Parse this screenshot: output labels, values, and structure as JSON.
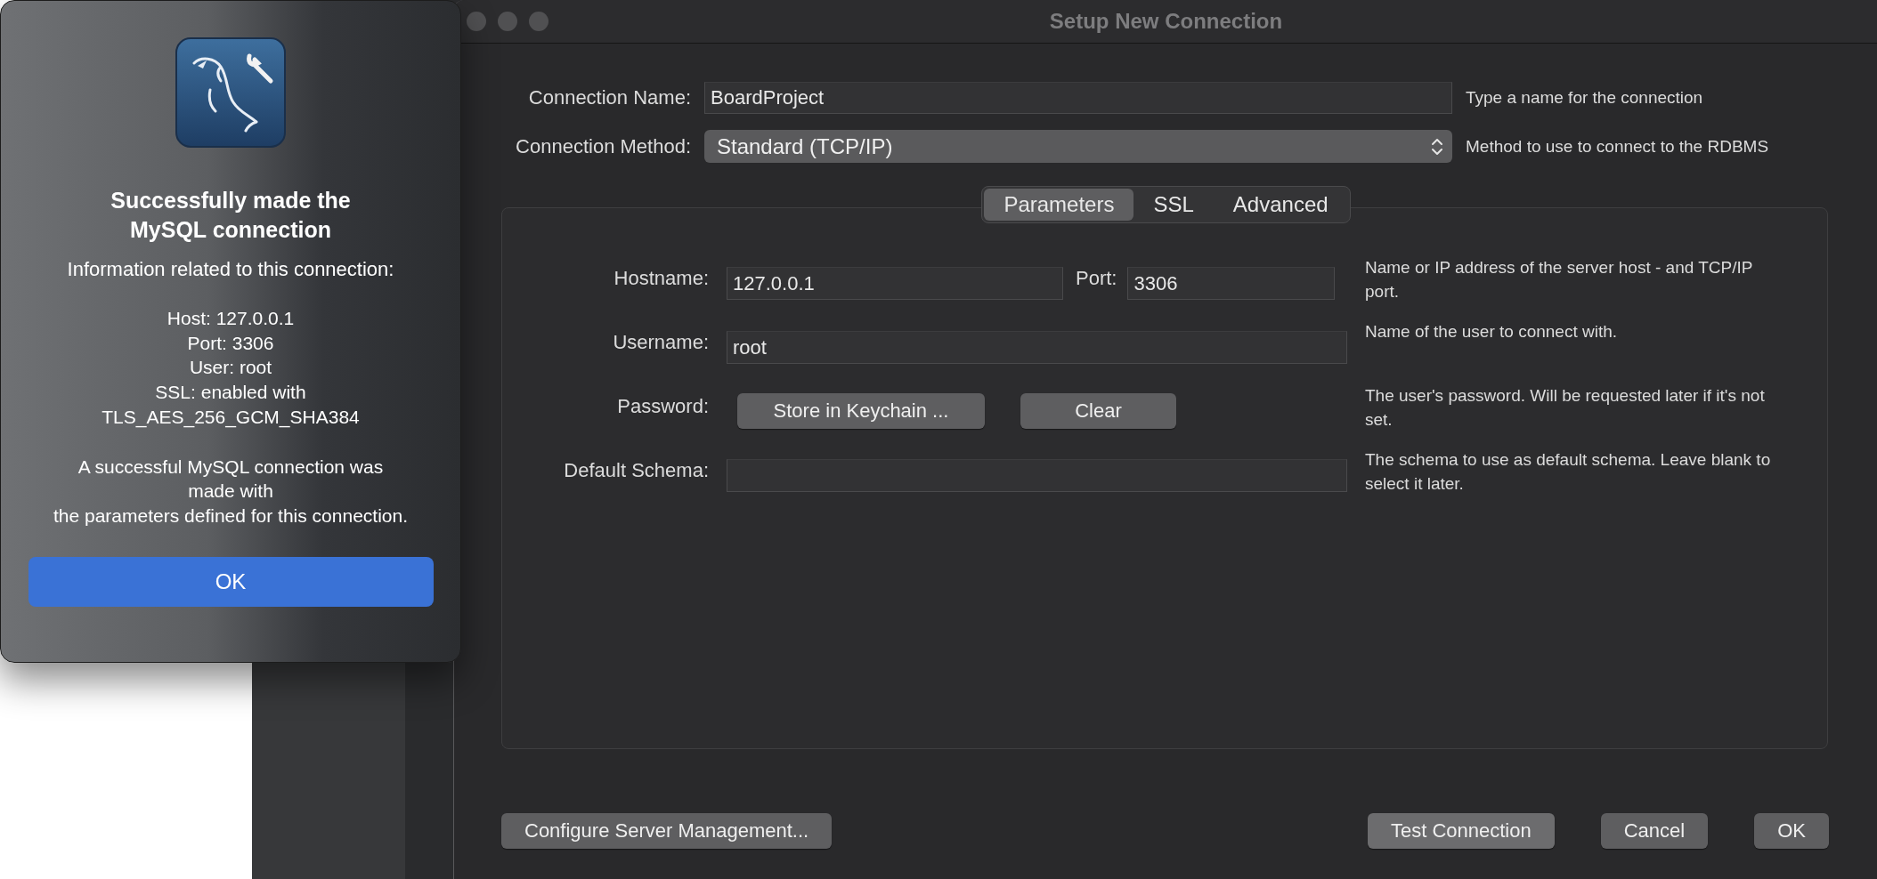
{
  "alert": {
    "title": "Successfully made the MySQL connection",
    "intro": "Information related to this connection:",
    "details": [
      "Host: 127.0.0.1",
      "Port: 3306",
      "User: root",
      "SSL: enabled with TLS_AES_256_GCM_SHA384"
    ],
    "message_lines": [
      "A successful MySQL connection was made with",
      "the parameters defined for this connection."
    ],
    "button": "OK"
  },
  "window": {
    "title": "Setup New Connection",
    "connection_name": {
      "label": "Connection Name:",
      "value": "BoardProject",
      "help": "Type a name for the connection"
    },
    "connection_method": {
      "label": "Connection Method:",
      "value": "Standard (TCP/IP)",
      "help": "Method to use to connect to the RDBMS"
    },
    "tabs": [
      {
        "label": "Parameters",
        "selected": true
      },
      {
        "label": "SSL",
        "selected": false
      },
      {
        "label": "Advanced",
        "selected": false
      }
    ],
    "parameters": {
      "hostname": {
        "label": "Hostname:",
        "value": "127.0.0.1"
      },
      "port": {
        "label": "Port:",
        "value": "3306"
      },
      "host_help": "Name or IP address of the server host - and TCP/IP port.",
      "username": {
        "label": "Username:",
        "value": "root",
        "help": "Name of the user to connect with."
      },
      "password": {
        "label": "Password:",
        "buttons": [
          "Store in Keychain ...",
          "Clear"
        ],
        "help": "The user's password. Will be requested later if it's not set."
      },
      "default_schema": {
        "label": "Default Schema:",
        "help": "The schema to use as default schema. Leave blank to select it later."
      }
    },
    "footer": {
      "left_button": "Configure Server Management...",
      "right_buttons": [
        "Test Connection",
        "Cancel",
        "OK"
      ]
    }
  }
}
